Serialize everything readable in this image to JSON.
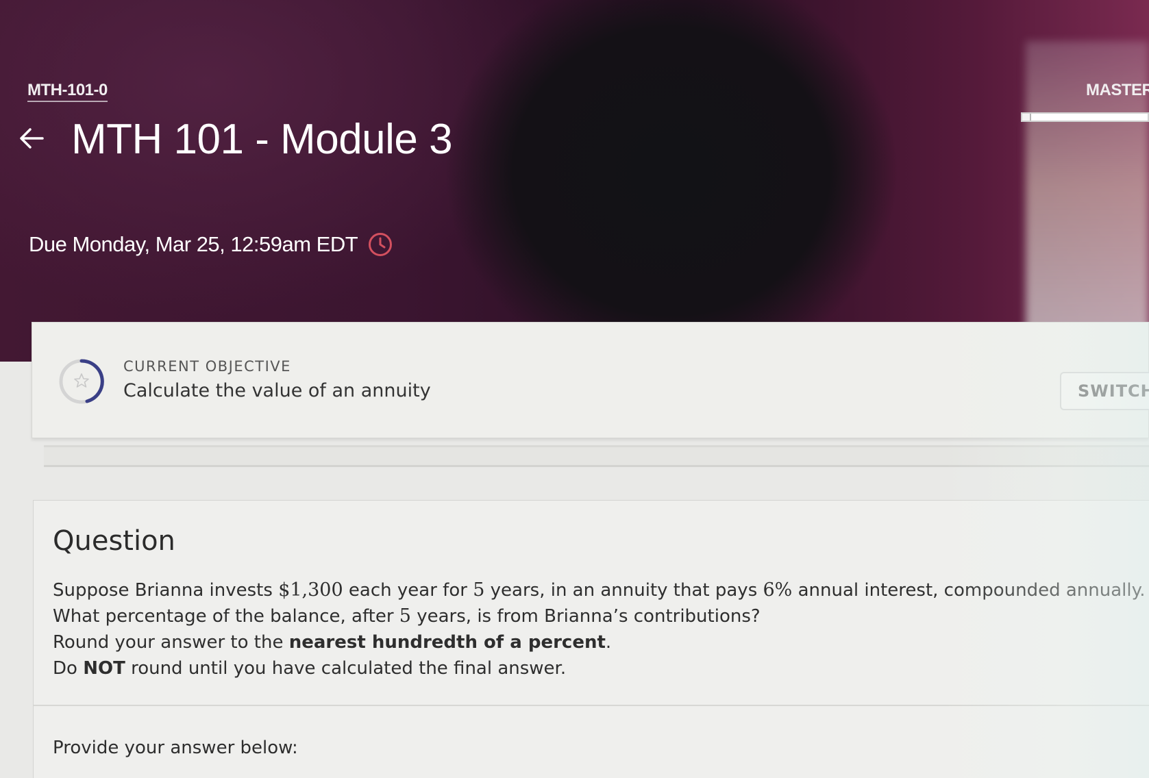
{
  "header": {
    "course_code": "MTH-101-0",
    "title": "MTH 101 - Module 3",
    "due": "Due Monday, Mar 25, 12:59am EDT",
    "mastery_label": "MASTERY",
    "mastery_progress": 0.05
  },
  "objective": {
    "label": "CURRENT OBJECTIVE",
    "text": "Calculate the value of an annuity",
    "switch_label": "SWITCH"
  },
  "question": {
    "heading": "Question",
    "line1_a": "Suppose Brianna invests ",
    "line1_amount": "$1,300",
    "line1_b": " each year for ",
    "line1_years": "5",
    "line1_c": " years, in an annuity that pays ",
    "line1_rate": "6%",
    "line1_d": " annual interest, compounded annually.",
    "line2_a": "What percentage of the balance, after ",
    "line2_years": "5",
    "line2_b": " years, is from Brianna’s contributions?",
    "line3_a": "Round your answer to the ",
    "line3_bold": "nearest hundredth of a percent",
    "line3_b": ".",
    "line4_a": "Do ",
    "line4_bold": "NOT",
    "line4_b": " round until you have calculated the final answer.",
    "answer_prompt": "Provide your answer below:"
  },
  "colors": {
    "banner": "#3b1530",
    "due_icon": "#c94a5a",
    "objective_ring": "#3a3f86"
  },
  "icons": {
    "back": "arrow-left-icon",
    "clock": "clock-icon",
    "objective": "star-icon"
  }
}
